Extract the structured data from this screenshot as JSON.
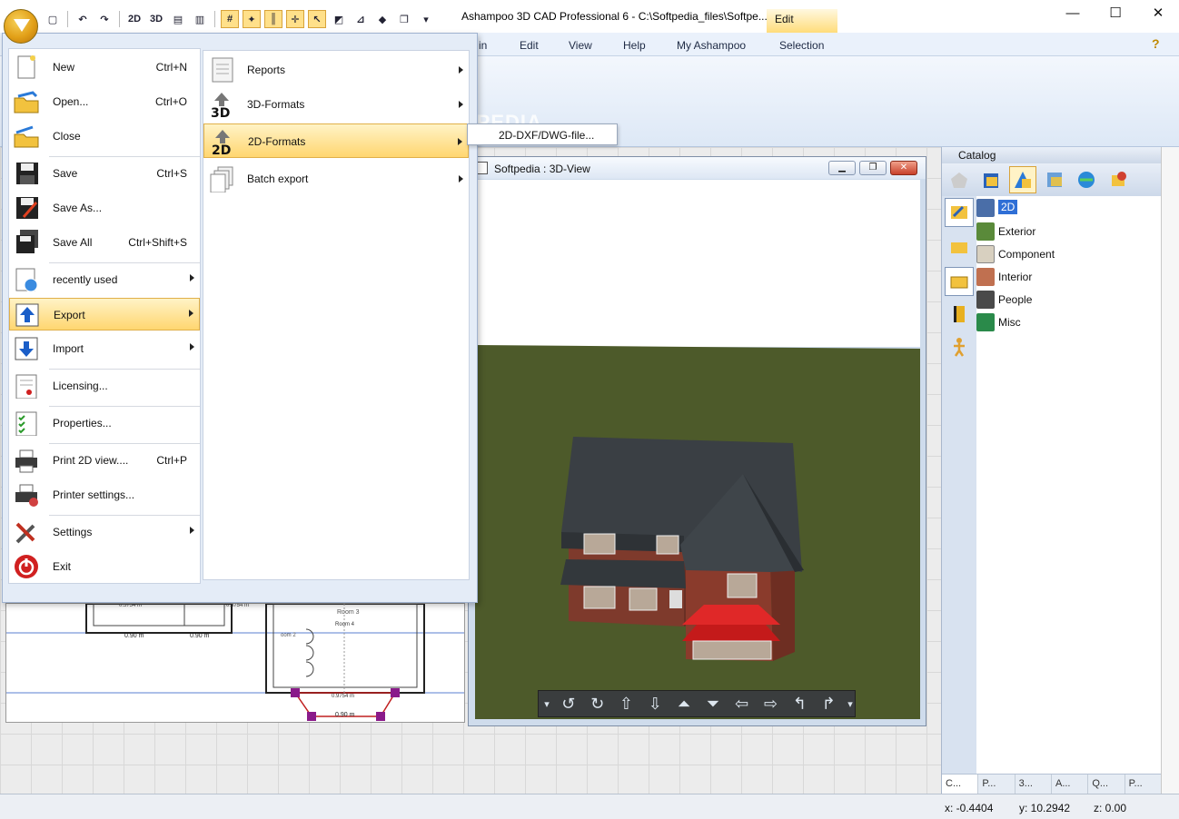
{
  "window": {
    "title": "Ashampoo 3D CAD Professional 6 - C:\\Softpedia_files\\Softpe...",
    "context_tab": "Edit",
    "minimize": "—",
    "maximize": "☐",
    "close": "✕"
  },
  "quick_access": {
    "btn_2d": "2D",
    "btn_3d": "3D"
  },
  "menu_tabs": [
    "in",
    "Edit",
    "View",
    "Help",
    "My Ashampoo",
    "Selection"
  ],
  "watermark": "SOFTPEDIA",
  "file_menu": {
    "items": [
      {
        "label": "New",
        "shortcut": "Ctrl+N"
      },
      {
        "label": "Open...",
        "shortcut": "Ctrl+O"
      },
      {
        "label": "Close",
        "shortcut": ""
      },
      {
        "label": "Save",
        "shortcut": "Ctrl+S"
      },
      {
        "label": "Save As...",
        "shortcut": ""
      },
      {
        "label": "Save All",
        "shortcut": "Ctrl+Shift+S"
      },
      {
        "label": "recently used",
        "shortcut": ""
      },
      {
        "label": "Export",
        "shortcut": ""
      },
      {
        "label": "Import",
        "shortcut": ""
      },
      {
        "label": "Licensing...",
        "shortcut": ""
      },
      {
        "label": "Properties...",
        "shortcut": ""
      },
      {
        "label": "Print 2D view....",
        "shortcut": "Ctrl+P"
      },
      {
        "label": "Printer settings...",
        "shortcut": ""
      },
      {
        "label": "Settings",
        "shortcut": ""
      },
      {
        "label": "Exit",
        "shortcut": ""
      }
    ],
    "submenu": [
      {
        "label": "Reports"
      },
      {
        "label": "3D-Formats"
      },
      {
        "label": "2D-Formats"
      },
      {
        "label": "Batch export"
      }
    ],
    "flyout": "2D-DXF/DWG-file..."
  },
  "view3d": {
    "title": "Softpedia : 3D-View"
  },
  "plan2d": {
    "room3": "Room 3",
    "room4": "Room 4",
    "room2": "oom 2",
    "dim1": "0.90 m",
    "dim2": "0.90 m",
    "dim3": "0.90 m",
    "dim_top1": "0.5754 m",
    "dim_top2": "0.5754 m",
    "dim_bay": "0.9754 m"
  },
  "catalog": {
    "title": "Catalog",
    "items": [
      {
        "label": "2D"
      },
      {
        "label": "Exterior"
      },
      {
        "label": "Component"
      },
      {
        "label": "Interior"
      },
      {
        "label": "People"
      },
      {
        "label": "Misc"
      }
    ],
    "tabs": [
      "C...",
      "P...",
      "3...",
      "A...",
      "Q...",
      "P..."
    ]
  },
  "status": {
    "x": "x: -0.4404",
    "y": "y: 10.2942",
    "z": "z: 0.00"
  },
  "colors": {
    "accent": "#ffd670",
    "roof": "#3a3f44",
    "brick": "#8a3b2c",
    "grass": "#4d5a2a"
  }
}
